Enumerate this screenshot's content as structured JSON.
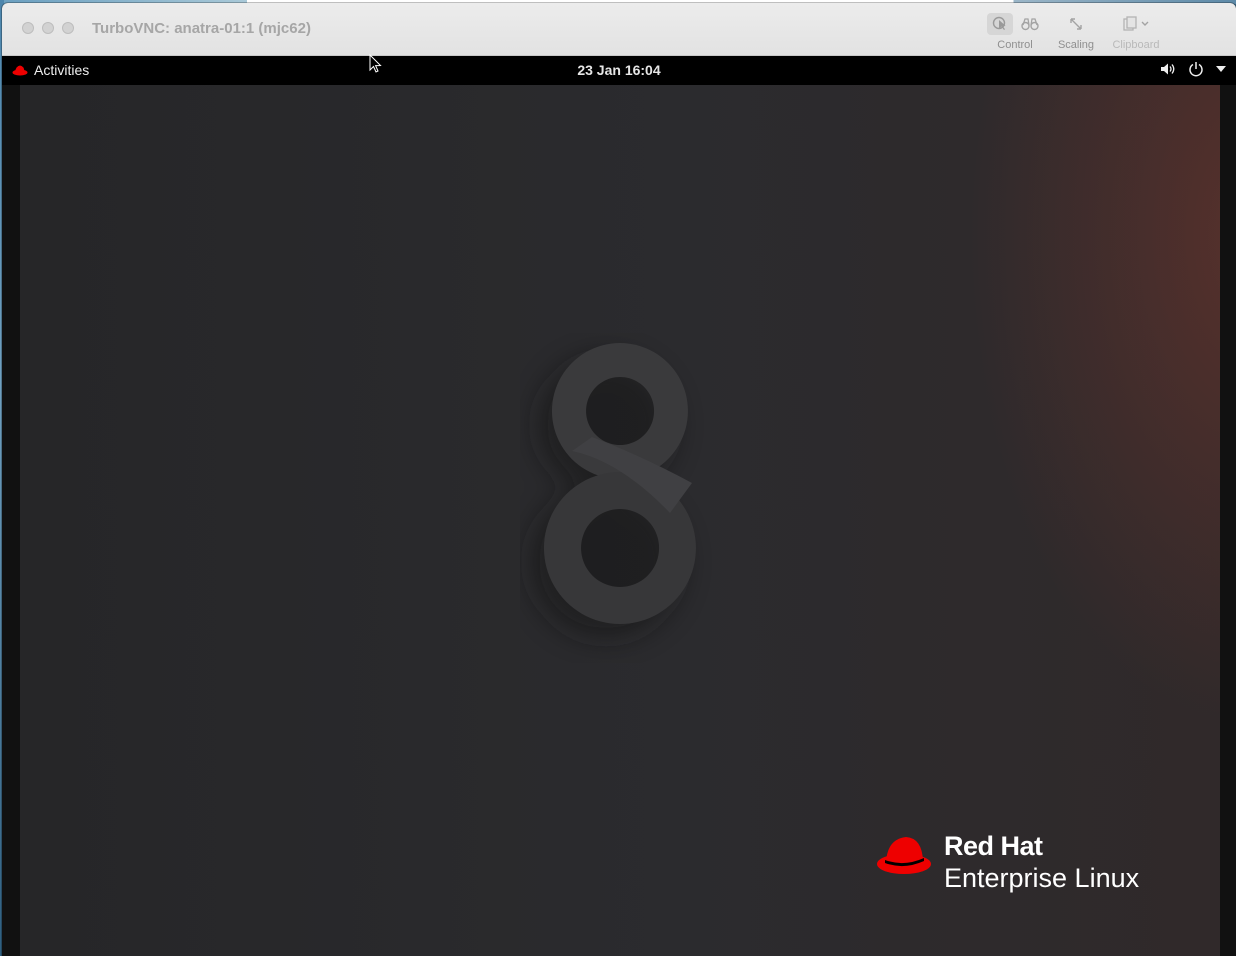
{
  "window": {
    "title": "TurboVNC: anatra-01:1 (mjc62)",
    "toolbar": {
      "control_label": "Control",
      "scaling_label": "Scaling",
      "clipboard_label": "Clipboard"
    }
  },
  "gnome": {
    "activities_label": "Activities",
    "clock": "23 Jan  16:04",
    "tray_icons": [
      "volume-icon",
      "power-icon",
      "menu-arrow-icon"
    ]
  },
  "wallpaper": {
    "logo_line1": "Red Hat",
    "logo_line2": "Enterprise Linux",
    "version_mark": "8"
  },
  "colors": {
    "redhat_red": "#ee0000",
    "panel": "#000000",
    "titlebar": "#e6e6e6"
  }
}
